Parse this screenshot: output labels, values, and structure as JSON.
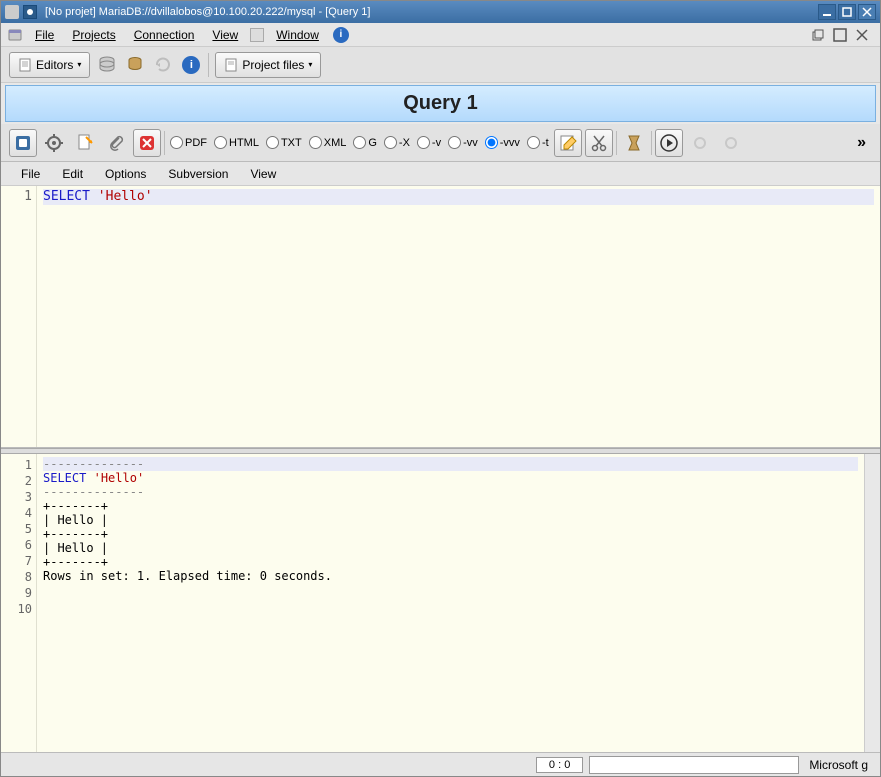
{
  "window": {
    "title": "[No projet] MariaDB://dvillalobos@10.100.20.222/mysql - [Query 1]"
  },
  "menubar": {
    "file": "File",
    "projects": "Projects",
    "connection": "Connection",
    "view": "View",
    "window": "Window"
  },
  "toolbar1": {
    "editors": "Editors",
    "project_files": "Project files"
  },
  "query_header": "Query 1",
  "toolbar2": {
    "radios": {
      "pdf": "PDF",
      "html": "HTML",
      "txt": "TXT",
      "xml": "XML",
      "g": "G",
      "x": "-X",
      "v": "-v",
      "vv": "-vv",
      "vvv": "-vvv",
      "t": "-t"
    },
    "selected": "-vvv",
    "overflow": "»"
  },
  "editor_menu": {
    "file": "File",
    "edit": "Edit",
    "options": "Options",
    "subversion": "Subversion",
    "view": "View"
  },
  "editor": {
    "line_number": "1",
    "kw": "SELECT",
    "str": "'Hello'"
  },
  "results": {
    "lines": [
      {
        "n": "1",
        "raw": "--------------"
      },
      {
        "n": "2",
        "kw": "SELECT",
        "str": "'Hello'"
      },
      {
        "n": "3",
        "raw": "--------------"
      },
      {
        "n": "4",
        "raw": "+-------+"
      },
      {
        "n": "5",
        "raw": "| Hello |"
      },
      {
        "n": "6",
        "raw": "+-------+"
      },
      {
        "n": "7",
        "raw": "| Hello |"
      },
      {
        "n": "8",
        "raw": "+-------+"
      },
      {
        "n": "9",
        "raw": "Rows in set: 1. Elapsed time: 0 seconds."
      },
      {
        "n": "10",
        "raw": ""
      }
    ]
  },
  "statusbar": {
    "pos": "0 : 0",
    "right": "Microsoft g"
  }
}
